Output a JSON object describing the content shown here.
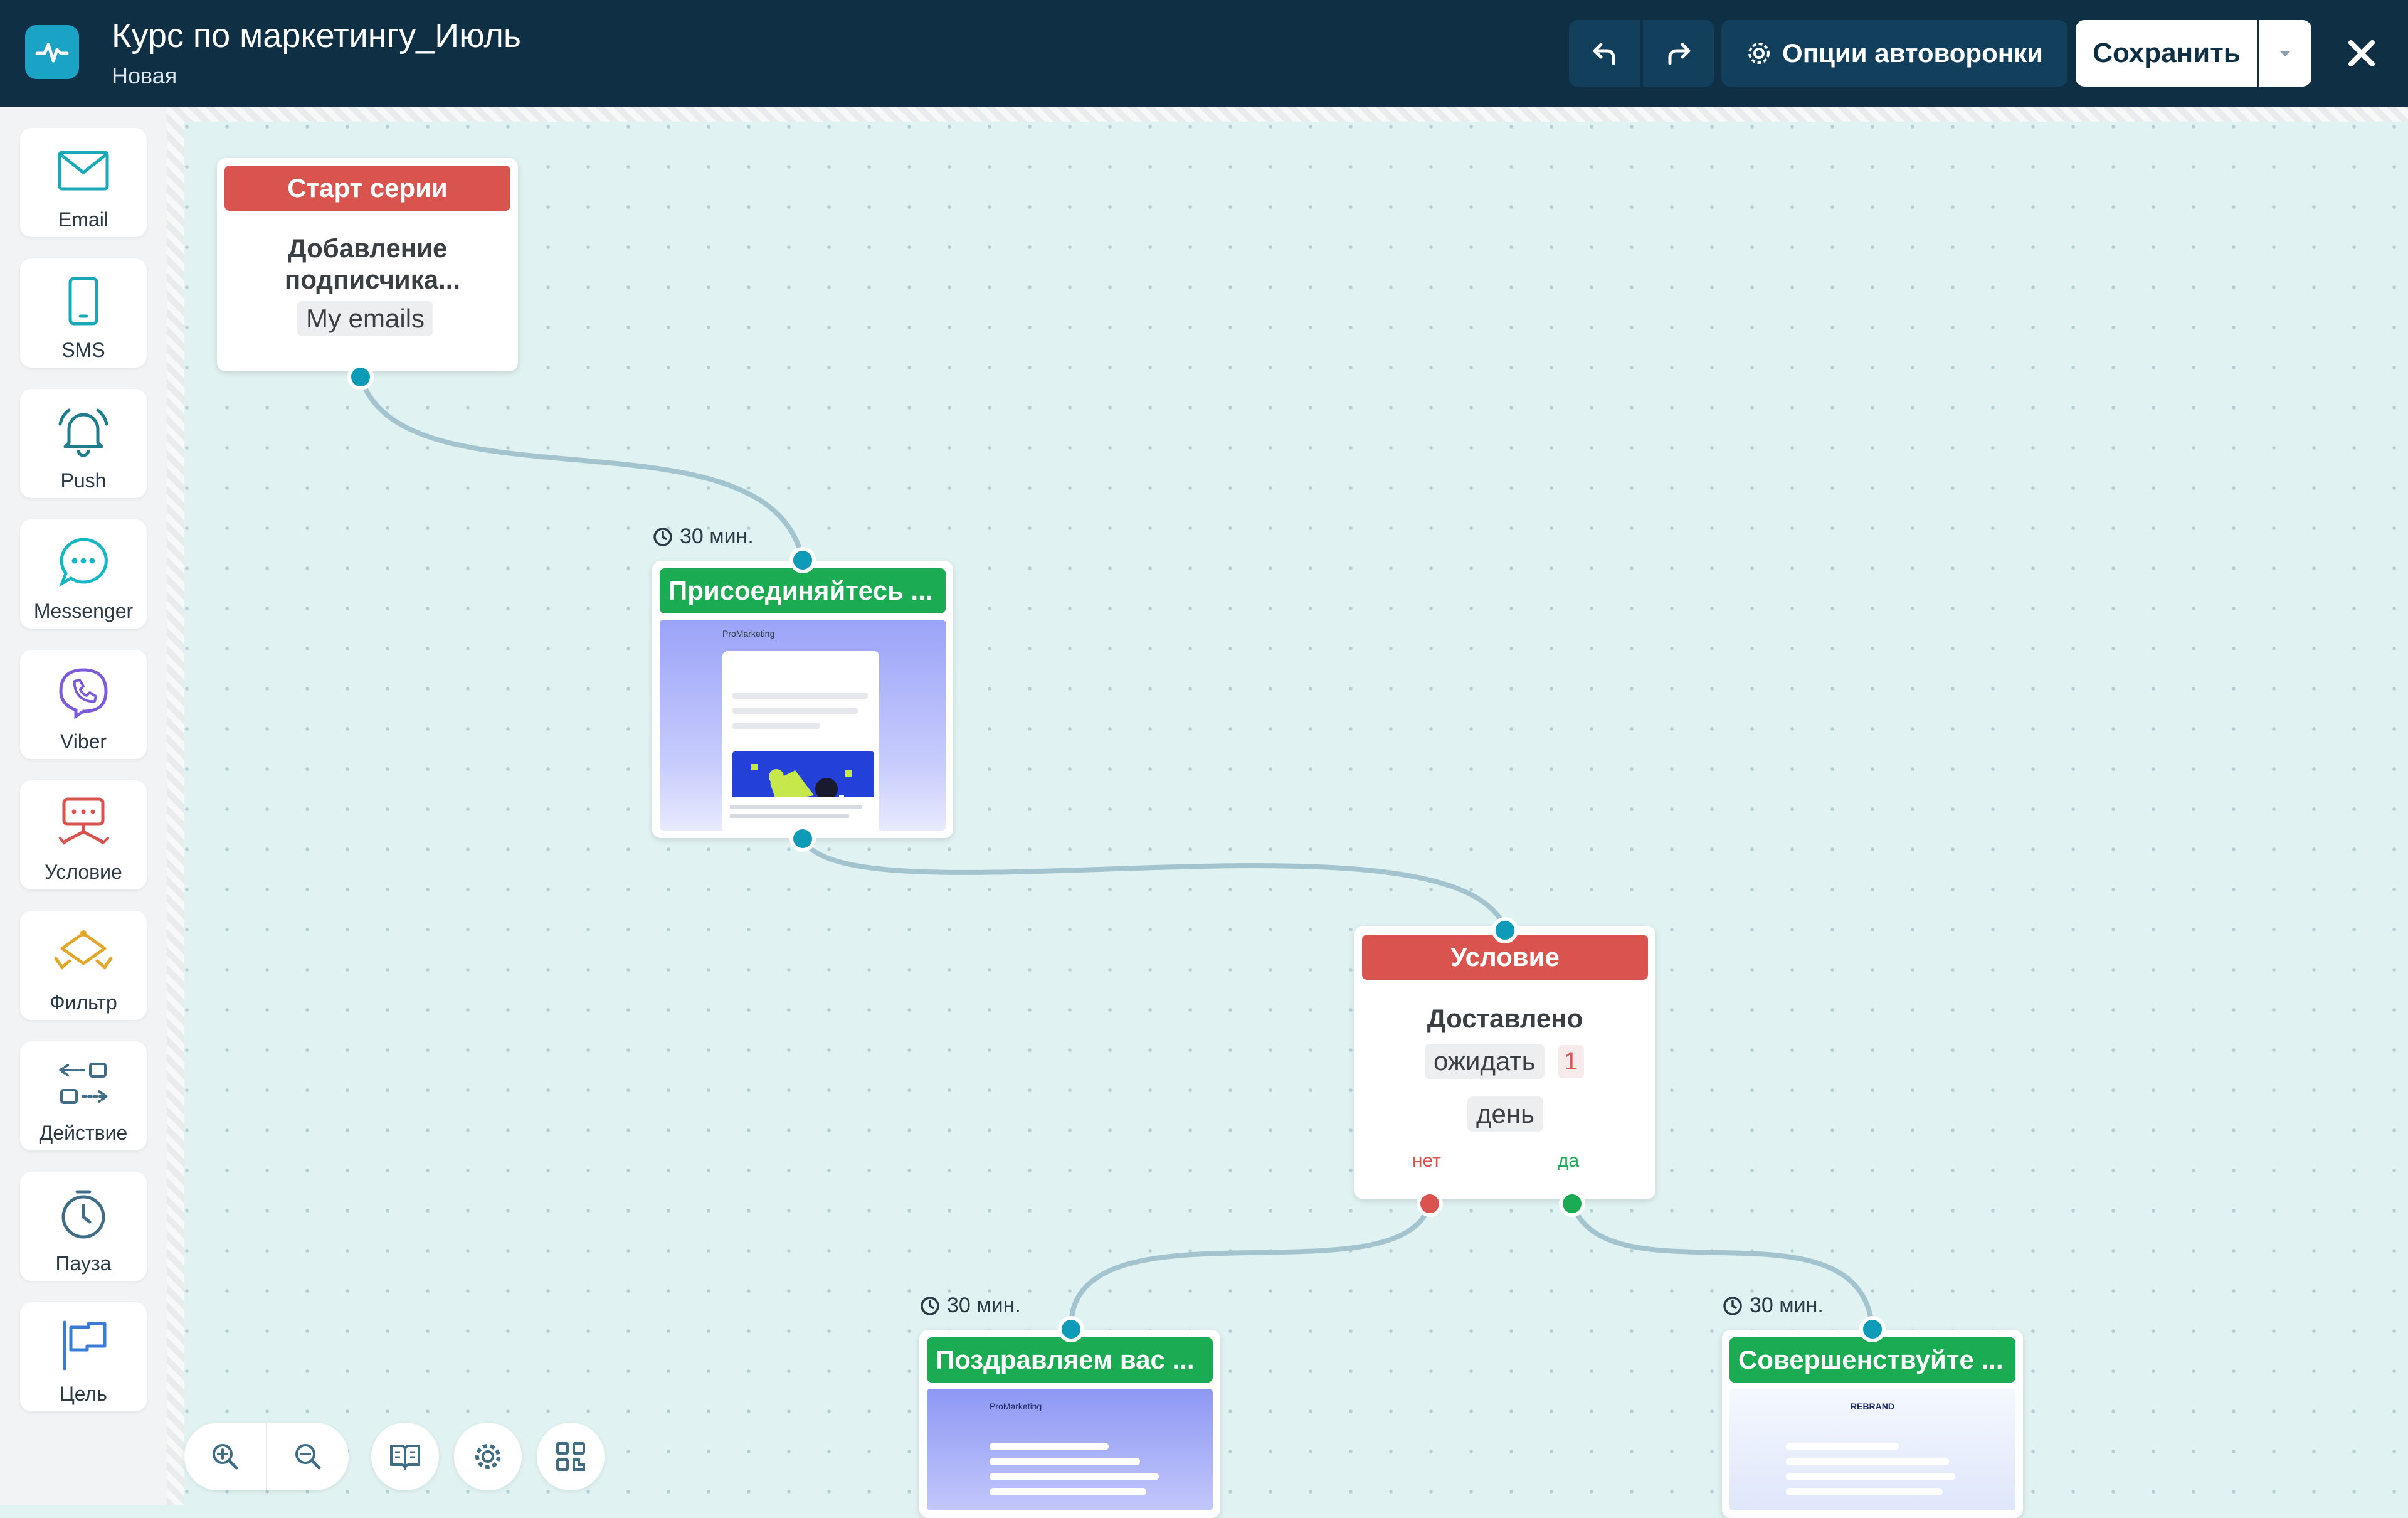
{
  "header": {
    "title": "Курс по маркетингу_Июль",
    "status": "Новая",
    "options_label": "Опции автоворонки",
    "save_label": "Сохранить"
  },
  "sidebar": {
    "items": [
      {
        "label": "Email",
        "icon": "envelope-icon"
      },
      {
        "label": "SMS",
        "icon": "phone-icon"
      },
      {
        "label": "Push",
        "icon": "bell-icon"
      },
      {
        "label": "Messenger",
        "icon": "chat-bubble-icon"
      },
      {
        "label": "Viber",
        "icon": "viber-icon"
      },
      {
        "label": "Условие",
        "icon": "condition-icon"
      },
      {
        "label": "Фильтр",
        "icon": "filter-icon"
      },
      {
        "label": "Действие",
        "icon": "action-icon"
      },
      {
        "label": "Пауза",
        "icon": "clock-icon"
      },
      {
        "label": "Цель",
        "icon": "flag-icon"
      }
    ]
  },
  "nodes": {
    "start": {
      "header": "Старт серии",
      "line1": "Добавление",
      "line2": "подписчика...",
      "list": "My emails"
    },
    "email1": {
      "timer": "30 мин.",
      "header": "Присоединяйтесь ...",
      "brand": "ProMarketing"
    },
    "condition": {
      "header": "Условие",
      "title": "Доставлено",
      "wait_label": "ожидать",
      "wait_value": "1",
      "unit": "день",
      "no_label": "нет",
      "yes_label": "да"
    },
    "email2": {
      "timer": "30 мин.",
      "header": "Поздравляем вас ...",
      "brand": "ProMarketing"
    },
    "email3": {
      "timer": "30 мин.",
      "header": "Совершенствуйте ...",
      "brand": "REBRAND"
    }
  },
  "colors": {
    "header_bg": "#0f2f45",
    "accent": "#1aa3c4",
    "start_red": "#d9534f",
    "email_green": "#1bab52",
    "port_blue": "#0e9bb7"
  }
}
